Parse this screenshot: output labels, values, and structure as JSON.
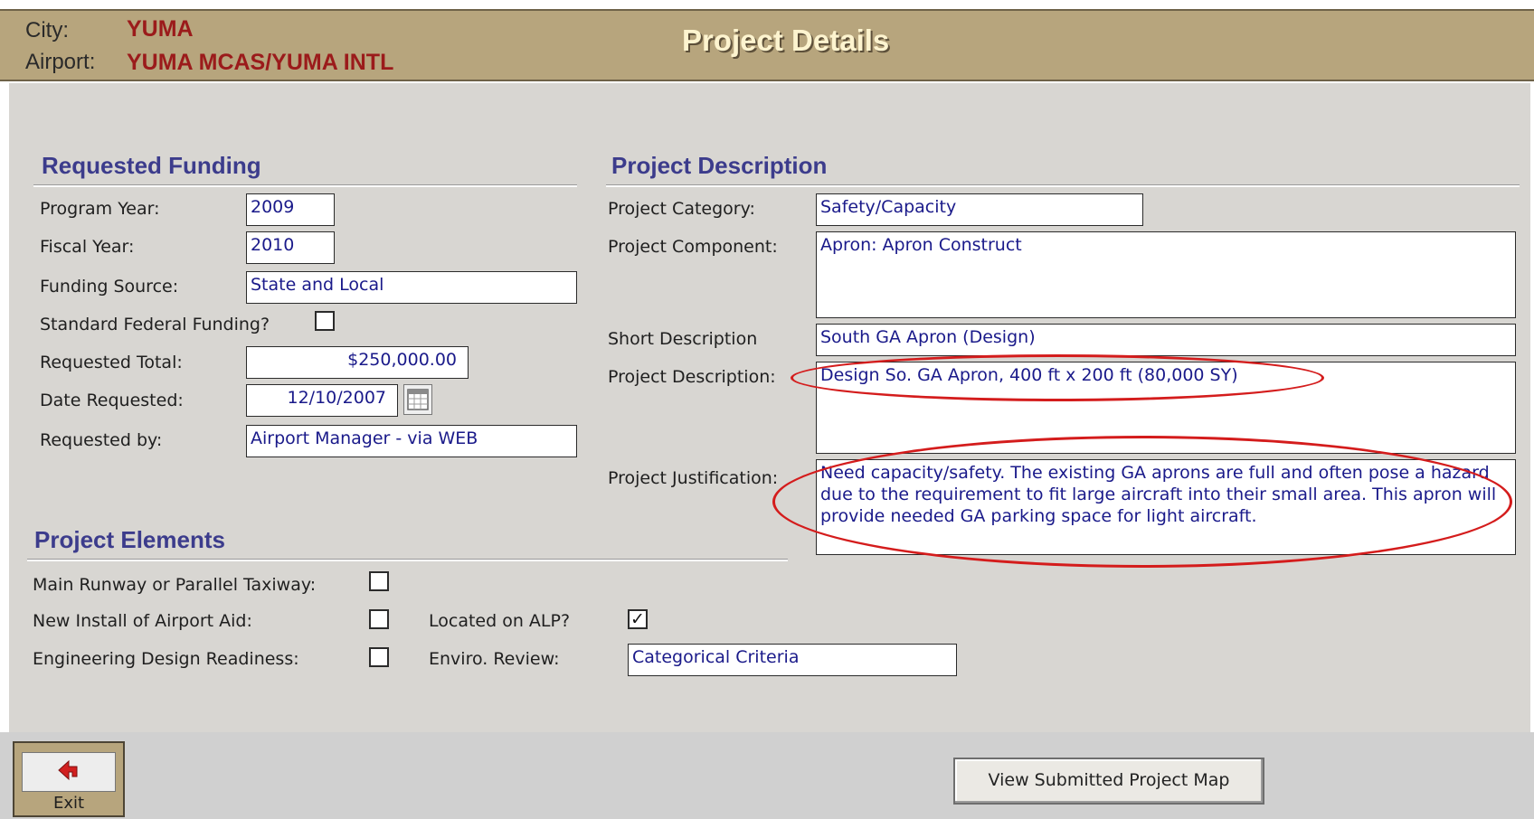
{
  "header": {
    "city_label": "City:",
    "city_value": "YUMA",
    "airport_label": "Airport:",
    "airport_value": "YUMA MCAS/YUMA INTL",
    "title": "Project Details"
  },
  "requested_funding": {
    "title": "Requested Funding",
    "program_year": {
      "label": "Program Year:",
      "value": "2009"
    },
    "fiscal_year": {
      "label": "Fiscal Year:",
      "value": "2010"
    },
    "funding_source": {
      "label": "Funding Source:",
      "value": "State and Local"
    },
    "standard_federal": {
      "label": "Standard Federal Funding?",
      "checked": false
    },
    "requested_total": {
      "label": "Requested Total:",
      "value": "$250,000.00"
    },
    "date_requested": {
      "label": "Date Requested:",
      "value": "12/10/2007"
    },
    "requested_by": {
      "label": "Requested by:",
      "value": "Airport Manager - via WEB"
    }
  },
  "project_description": {
    "title": "Project Description",
    "category": {
      "label": "Project Category:",
      "value": "Safety/Capacity"
    },
    "component": {
      "label": "Project Component:",
      "value": "Apron: Apron Construct"
    },
    "short_description": {
      "label": "Short Description",
      "value": "South GA Apron (Design)"
    },
    "description": {
      "label": "Project Description:",
      "value": "Design So. GA Apron, 400 ft x 200 ft (80,000 SY)"
    },
    "justification": {
      "label": "Project Justification:",
      "value": "Need capacity/safety. The existing GA aprons are full and often pose a hazard due to the requirement to fit large aircraft into their small area. This apron will provide needed GA parking space for light aircraft."
    }
  },
  "project_elements": {
    "title": "Project Elements",
    "main_runway": {
      "label": "Main Runway or Parallel Taxiway:",
      "checked": false
    },
    "new_install": {
      "label": "New Install of Airport Aid:",
      "checked": false
    },
    "located_alp": {
      "label": "Located on ALP?",
      "checked": true
    },
    "design_readiness": {
      "label": "Engineering Design Readiness:",
      "checked": false
    },
    "enviro_review": {
      "label": "Enviro. Review:",
      "value": "Categorical Criteria"
    }
  },
  "footer": {
    "exit_label": "Exit",
    "exit_icon": "red-arrow-left-icon",
    "view_map_label": "View Submitted Project Map"
  },
  "colors": {
    "header_bg": "#b7a57d",
    "panel_bg": "#d8d6d2",
    "section_title": "#3c3c8c",
    "field_text": "#1a1a8a",
    "header_value": "#9b1b1b",
    "highlight_oval": "#d41c1c"
  }
}
